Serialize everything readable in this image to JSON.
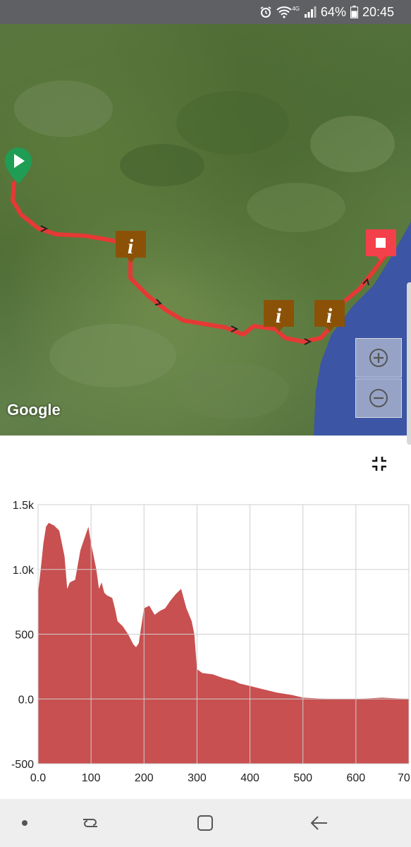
{
  "status_bar": {
    "network_label": "4G",
    "battery": "64%",
    "time": "20:45",
    "icons": [
      "alarm-icon",
      "wifi-icon",
      "signal-icon",
      "battery-icon"
    ]
  },
  "map": {
    "logo": "Google",
    "markers": [
      "start-marker",
      "info-marker",
      "info-marker",
      "info-marker",
      "end-marker"
    ],
    "route_color": "#e53935",
    "zoom_in_icon": "plus-circle-icon",
    "zoom_out_icon": "minus-circle-icon"
  },
  "chart_data": {
    "type": "area",
    "xlim": [
      0,
      700
    ],
    "ylim": [
      -500,
      1500
    ],
    "x_ticks": [
      "0.0",
      "100",
      "200",
      "300",
      "400",
      "500",
      "600",
      "70"
    ],
    "y_ticks": [
      "1.5k",
      "1.0k",
      "500",
      "0.0",
      "-500"
    ],
    "grid": true,
    "fill_color": "#c85050",
    "x": [
      0,
      5,
      10,
      15,
      20,
      30,
      40,
      50,
      55,
      60,
      70,
      80,
      90,
      95,
      100,
      110,
      115,
      120,
      125,
      130,
      140,
      145,
      150,
      160,
      170,
      175,
      180,
      185,
      190,
      200,
      210,
      220,
      230,
      240,
      250,
      260,
      270,
      280,
      290,
      295,
      300,
      310,
      330,
      350,
      370,
      380,
      400,
      420,
      450,
      480,
      500,
      550,
      600,
      650,
      700
    ],
    "y": [
      820,
      1000,
      1200,
      1330,
      1360,
      1340,
      1300,
      1100,
      850,
      900,
      920,
      1150,
      1270,
      1330,
      1200,
      1000,
      850,
      900,
      820,
      800,
      780,
      700,
      600,
      560,
      500,
      460,
      420,
      400,
      430,
      700,
      720,
      650,
      680,
      700,
      760,
      810,
      850,
      700,
      600,
      500,
      230,
      200,
      190,
      160,
      140,
      120,
      100,
      80,
      50,
      30,
      10,
      0,
      0,
      10,
      0
    ]
  },
  "nav_bar": {
    "items": [
      "recents-dot-icon",
      "recent-apps-icon",
      "home-icon",
      "back-icon"
    ]
  }
}
